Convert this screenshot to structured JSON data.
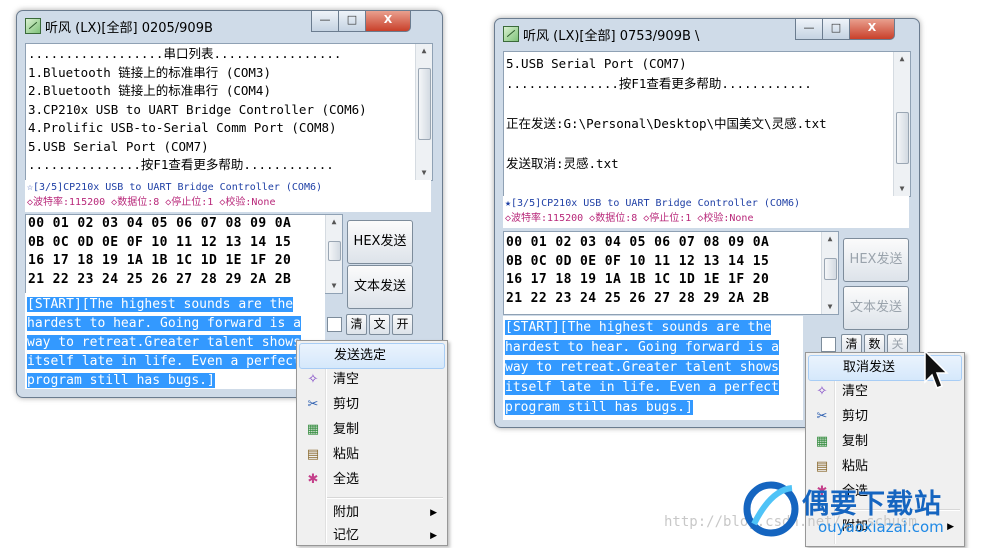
{
  "left_window": {
    "title": "听风 (LX)[全部] 0205/909B",
    "btn_min": "—",
    "btn_max": "□",
    "btn_close": "X",
    "port_list": [
      "..................串口列表.................",
      "1.Bluetooth 链接上的标准串行 (COM3)",
      "2.Bluetooth 链接上的标准串行 (COM4)",
      "3.CP210x USB to UART Bridge Controller (COM6)",
      "4.Prolific USB-to-Serial Comm Port (COM8)",
      "5.USB Serial Port (COM7)",
      "...............按F1查看更多帮助............"
    ],
    "status_line1": "☆[3/5]CP210x USB to UART Bridge Controller (COM6)",
    "status_line2": "◇波特率:115200 ◇数据位:8 ◇停止位:1 ◇校验:None",
    "hex_lines": [
      "00 01 02 03 04 05 06 07 08 09 0A",
      "0B 0C 0D 0E 0F 10 11 12 13 14 15",
      "16 17 18 19 1A 1B 1C 1D 1E 1F 20",
      "21 22 23 24 25 26 27 28 29 2A 2B"
    ],
    "hex_send": "HEX发送",
    "text_send": "文本发送",
    "btn_clear": "清",
    "btn_text": "文",
    "btn_open": "开",
    "selected_text": [
      "[START][The highest sounds are the",
      "hardest to hear. Going forward is a",
      "way to retreat.Greater talent shows",
      "itself late in life. Even a perfect",
      "program still has bugs.]"
    ],
    "context_menu": {
      "items": [
        {
          "label": "发送选定",
          "icon": "",
          "highlighted": true
        },
        {
          "label": "清空",
          "icon": "clear-icon"
        },
        {
          "label": "剪切",
          "icon": "scissors-icon"
        },
        {
          "label": "复制",
          "icon": "copy-icon"
        },
        {
          "label": "粘贴",
          "icon": "paste-icon"
        },
        {
          "label": "全选",
          "icon": "select-all-icon"
        },
        {
          "label": "附加",
          "submenu": true
        },
        {
          "label": "记忆",
          "submenu": true
        }
      ]
    }
  },
  "right_window": {
    "title": "听风 (LX)[全部] 0753/909B \\",
    "btn_min": "—",
    "btn_max": "□",
    "btn_close": "X",
    "log_lines": [
      "5.USB Serial Port (COM7)",
      "...............按F1查看更多帮助............",
      "",
      "正在发送:G:\\Personal\\Desktop\\中国美文\\灵感.txt",
      "",
      "发送取消:灵感.txt"
    ],
    "status_line1": "★[3/5]CP210x USB to UART Bridge Controller (COM6)",
    "status_line2": "◇波特率:115200 ◇数据位:8 ◇停止位:1 ◇校验:None",
    "hex_lines": [
      "00 01 02 03 04 05 06 07 08 09 0A",
      "0B 0C 0D 0E 0F 10 11 12 13 14 15",
      "16 17 18 19 1A 1B 1C 1D 1E 1F 20",
      "21 22 23 24 25 26 27 28 29 2A 2B"
    ],
    "hex_send": "HEX发送",
    "text_send": "文本发送",
    "btn_clear": "清",
    "btn_num": "数",
    "btn_close_port": "关",
    "selected_text": [
      "[START][The highest sounds are the",
      "hardest to hear. Going forward is a",
      "way to retreat.Greater talent shows",
      "itself late in life. Even a perfect",
      "program still has bugs.]"
    ],
    "context_menu": {
      "items": [
        {
          "label": "取消发送",
          "highlighted": true
        },
        {
          "label": "清空",
          "icon": "clear-icon"
        },
        {
          "label": "剪切",
          "icon": "scissors-icon"
        },
        {
          "label": "复制",
          "icon": "copy-icon"
        },
        {
          "label": "粘贴",
          "icon": "paste-icon"
        },
        {
          "label": "全选",
          "icon": "select-all-icon"
        },
        {
          "label": "附加",
          "submenu": true
        }
      ]
    }
  },
  "watermark": {
    "url": "http://blog.csdn.net/...schusm",
    "logo_cn": "偶要下载站",
    "logo_en": "ouyaoxiazai.com"
  },
  "colors": {
    "selection": "#3399ff",
    "status_blue": "#1e3fa5",
    "status_magenta": "#b8287a",
    "logo_blue": "#1565c0"
  }
}
